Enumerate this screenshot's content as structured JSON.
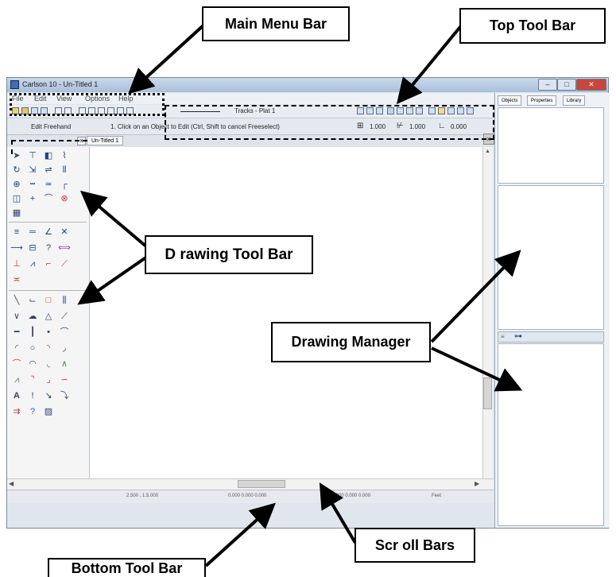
{
  "window": {
    "title": "Carlson 10 - Un-Titled 1",
    "controls": {
      "minimize": "–",
      "maximize": "□",
      "close": "✕"
    }
  },
  "menu": [
    "File",
    "Edit",
    "View",
    "Options",
    "Help"
  ],
  "top_toolbar": {
    "layer_label": "Tracks - Plat 1"
  },
  "edit_toolbar": {
    "mode": "Edit Freehand",
    "prompt": "1. Click on an Object to Edit (Ctrl, Shift to cancel Freeselect)",
    "value_1": "1.000",
    "value_2": "1.000",
    "value_3": "0.000"
  },
  "document_tab": "Un-Titled 1",
  "side_tabs": [
    "Objects",
    "Properties",
    "Library"
  ],
  "status_bar": [
    "2.500  ,  1.5.000",
    "0.000 0.000  0.000",
    "Al: 0.000 0.000 0.000",
    "Feet"
  ],
  "callouts": {
    "main_menu": "Main Menu Bar",
    "top_toolbar": "Top Tool  Bar",
    "drawing_toolbar": "D rawing Tool  Bar",
    "drawing_manager": "Drawing Manager",
    "bottom_toolbar": "Bottom Tool Bar",
    "scroll_bars": "Scr oll Bars"
  }
}
